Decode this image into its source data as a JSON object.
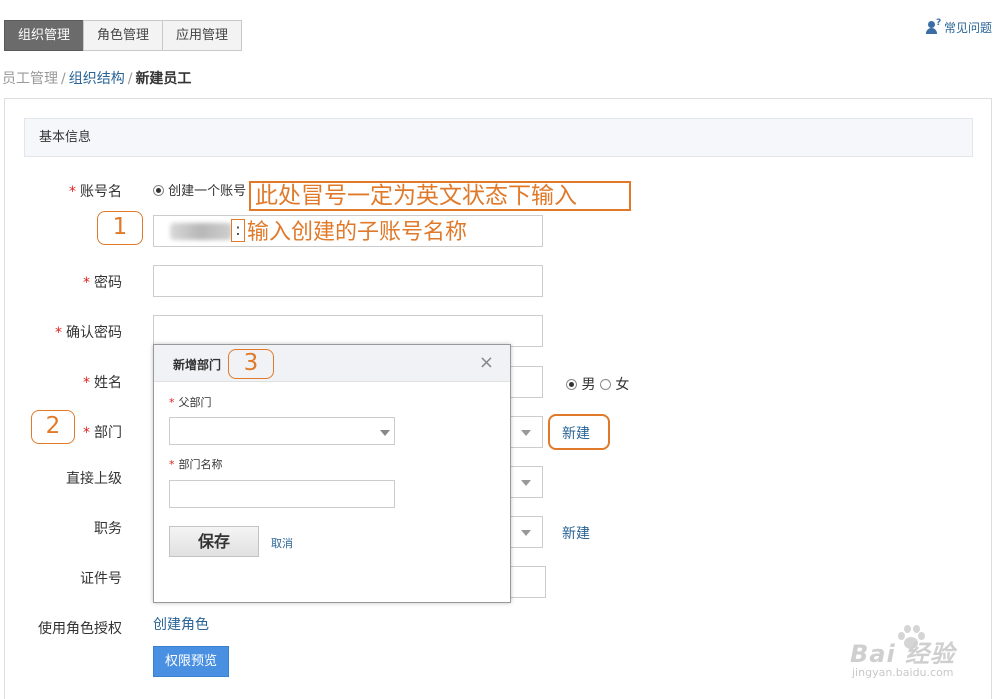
{
  "tabs": [
    {
      "label": "组织管理",
      "active": true
    },
    {
      "label": "角色管理",
      "active": false
    },
    {
      "label": "应用管理",
      "active": false
    }
  ],
  "faq": {
    "label": "常见问题",
    "icon": "user-question-icon"
  },
  "breadcrumb": {
    "item1": "员工管理",
    "item2": "组织结构",
    "current": "新建员工",
    "separator": "/"
  },
  "section": {
    "title": "基本信息"
  },
  "form": {
    "required_mark": "*",
    "account": {
      "label": "账号名",
      "radio_label": "创建一个账号",
      "separator": ":"
    },
    "password": {
      "label": "密码"
    },
    "confirm_password": {
      "label": "确认密码"
    },
    "name": {
      "label": "姓名",
      "gender_male": "男",
      "gender_female": "女",
      "selected": "男"
    },
    "department": {
      "label": "部门",
      "new_link": "新建"
    },
    "supervisor": {
      "label": "直接上级"
    },
    "position": {
      "label": "职务",
      "new_link": "新建"
    },
    "id_number": {
      "label": "证件号"
    },
    "role_auth": {
      "label": "使用角色授权",
      "create_role_link": "创建角色"
    },
    "perm_preview_button": "权限预览"
  },
  "modal": {
    "title": "新增部门",
    "close": "×",
    "parent_dept_label": "父部门",
    "dept_name_label": "部门名称",
    "save_button": "保存",
    "cancel_link": "取消"
  },
  "annotations": {
    "note_top": "此处冒号一定为英文状态下输入",
    "note_second": "输入创建的子账号名称",
    "badge1": "1",
    "badge2": "2",
    "badge3": "3",
    "color": "#e07a2a"
  },
  "watermark": {
    "brand": "Bai 经验",
    "url": "jingyan.baidu.com"
  },
  "colors": {
    "accent": "#4a90e2",
    "link": "#2a6496",
    "required": "#e02020",
    "tab_active": "#6b6b6b"
  }
}
